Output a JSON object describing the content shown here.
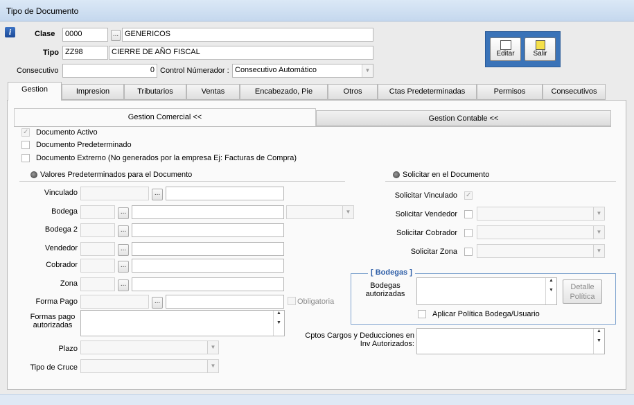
{
  "window": {
    "title": "Tipo de Documento"
  },
  "header": {
    "clase_label": "Clase",
    "clase_code": "0000",
    "clase_name": "GENERICOS",
    "tipo_label": "Tipo",
    "tipo_code": "ZZ98",
    "tipo_name": "CIERRE DE AÑO FISCAL",
    "consecutivo_label": "Consecutivo",
    "consecutivo_value": "0",
    "control_label": "Control Númerador :",
    "control_value": "Consecutivo Automático",
    "lookup_button": "..."
  },
  "toolbar": {
    "edit_label": "Editar",
    "exit_label": "Salir"
  },
  "tabs": [
    {
      "label": "Gestion",
      "active": true
    },
    {
      "label": "Impresion"
    },
    {
      "label": "Tributarios"
    },
    {
      "label": "Ventas"
    },
    {
      "label": "Encabezado, Pie"
    },
    {
      "label": "Otros"
    },
    {
      "label": "Ctas Predeterminadas"
    },
    {
      "label": "Permisos"
    },
    {
      "label": "Consecutivos"
    }
  ],
  "gestion": {
    "subtab_comercial": "Gestion Comercial <<",
    "subtab_contable": "Gestion Contable <<",
    "chk_activo": {
      "label": "Documento Activo",
      "checked": true
    },
    "chk_predeterminado": {
      "label": "Documento Predeterminado",
      "checked": false
    },
    "chk_externo": {
      "label": "Documento Extrerno (No generados por la empresa  Ej: Facturas de Compra)",
      "checked": false
    },
    "valores_title": "Valores Predeterminados para el Documento",
    "solicitar_title": "Solicitar en el Documento",
    "fields": {
      "vinculado": "Vinculado",
      "bodega": "Bodega",
      "bodega2": "Bodega 2",
      "vendedor": "Vendedor",
      "cobrador": "Cobrador",
      "zona": "Zona",
      "forma_pago": "Forma Pago",
      "obligatoria": "Obligatoria",
      "formas_pago_autorizadas": "Formas pago autorizadas",
      "plazo": "Plazo",
      "tipo_cruce": "Tipo de Cruce"
    },
    "solicitar": {
      "vinculado": "Solicitar Vinculado",
      "vendedor": "Solicitar Vendedor",
      "cobrador": "Solicitar Cobrador",
      "zona": "Solicitar Zona"
    },
    "bodegas": {
      "title": "[ Bodegas ]",
      "autorizadas": "Bodegas autorizadas",
      "detalle_button": "Detalle Política",
      "aplicar": "Aplicar Política Bodega/Usuario"
    },
    "cptos_label": "Cptos Cargos y Deducciones en Inv Autorizados:"
  },
  "colors": {
    "accent": "#3a73b8",
    "titlebar": "#c5d8ee",
    "groupbox_title": "#2f5fa8"
  }
}
